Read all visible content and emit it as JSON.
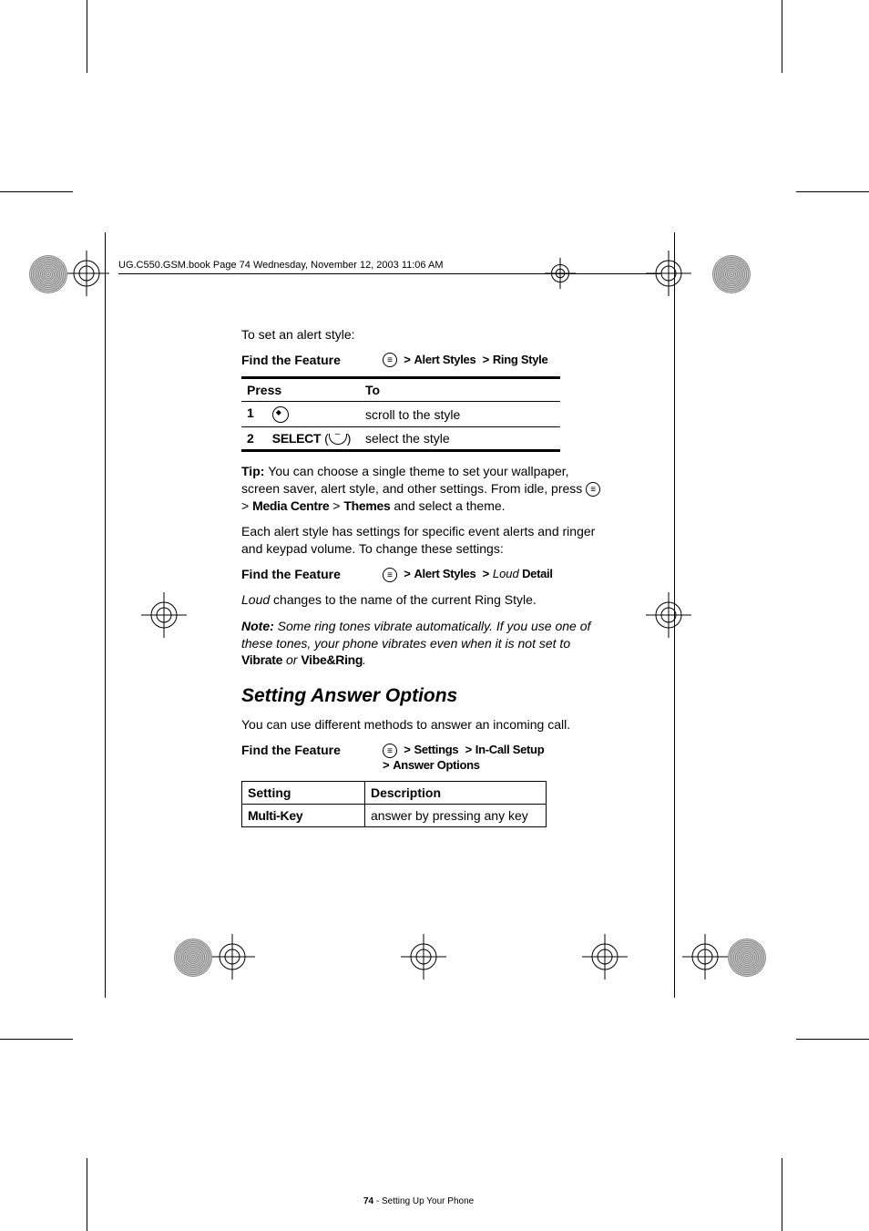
{
  "header": "UG.C550.GSM.book  Page 74  Wednesday, November 12, 2003  11:06 AM",
  "intro": "To set an alert style:",
  "feature_label": "Find the Feature",
  "path1": {
    "a": "Alert Styles",
    "b": "Ring Style"
  },
  "table1": {
    "head_press": "Press",
    "head_to": "To",
    "row1_to": "scroll to the style",
    "row2_press": "SELECT",
    "row2_to": "select the style"
  },
  "tip_label": "Tip: ",
  "tip_text_a": "You can choose a single theme to set your wallpaper, screen saver, alert style, and other settings. From idle, press ",
  "tip_text_b": " > ",
  "tip_media": "Media Centre",
  "tip_gt2": " > ",
  "tip_themes": "Themes",
  "tip_text_c": " and select a theme.",
  "para2": "Each alert style has settings for specific event alerts and ringer and keypad volume. To change these settings:",
  "path2": {
    "a": "Alert Styles",
    "loud": "Loud",
    "b": " Detail"
  },
  "loud_note": " changes to the name of the current Ring Style.",
  "loud_word": "Loud",
  "note_label": "Note: ",
  "note_text_a": "Some ring tones vibrate automatically. If you use one of these tones, your phone vibrates even when it is not set to ",
  "vibrate": "Vibrate",
  "note_or": " or ",
  "vibering": "Vibe&Ring",
  "note_period": ".",
  "heading": "Setting Answer Options",
  "para3": "You can use different methods to answer an incoming call.",
  "path3": {
    "a": "Settings",
    "b": "In-Call Setup",
    "c": "Answer Options"
  },
  "table2": {
    "head_setting": "Setting",
    "head_desc": "Description",
    "row1_setting": "Multi-Key",
    "row1_desc": "answer by pressing any key"
  },
  "footer_page": "74",
  "footer_text": " - Setting Up Your Phone"
}
